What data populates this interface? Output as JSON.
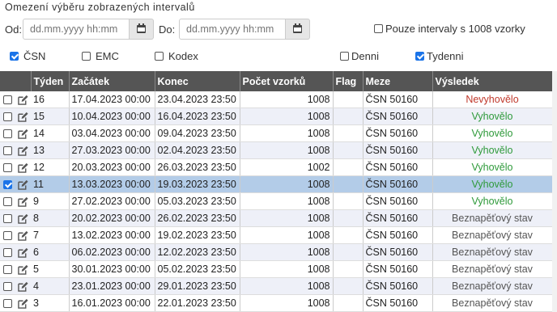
{
  "filter": {
    "heading": "Omezení výběru zobrazených intervalů",
    "from_label": "Od:",
    "to_label": "Do:",
    "from_placeholder": "dd.mm.yyyy hh:mm",
    "to_placeholder": "dd.mm.yyyy hh:mm",
    "only_full_label": "Pouze intervaly s 1008 vzorky",
    "only_full_checked": false,
    "options": [
      {
        "label": "ČSN",
        "checked": true
      },
      {
        "label": "EMC",
        "checked": false
      },
      {
        "label": "Kodex",
        "checked": false
      },
      {
        "label": "Denni",
        "checked": false
      },
      {
        "label": "Tydenni",
        "checked": true
      }
    ]
  },
  "table": {
    "columns": [
      "Týden",
      "Začátek",
      "Konec",
      "Počet vzorků",
      "Flag",
      "Meze",
      "Výsledek"
    ],
    "rows": [
      {
        "checked": false,
        "week": "16",
        "start": "17.04.2023 00:00",
        "end": "23.04.2023 23:50",
        "count": "1008",
        "flag": "",
        "limit": "ČSN 50160",
        "result": "Nevyhovělo",
        "status": "bad"
      },
      {
        "checked": false,
        "week": "15",
        "start": "10.04.2023 00:00",
        "end": "16.04.2023 23:50",
        "count": "1008",
        "flag": "",
        "limit": "ČSN 50160",
        "result": "Vyhovělo",
        "status": "ok"
      },
      {
        "checked": false,
        "week": "14",
        "start": "03.04.2023 00:00",
        "end": "09.04.2023 23:50",
        "count": "1008",
        "flag": "",
        "limit": "ČSN 50160",
        "result": "Vyhovělo",
        "status": "ok"
      },
      {
        "checked": false,
        "week": "13",
        "start": "27.03.2023 00:00",
        "end": "02.04.2023 23:50",
        "count": "1008",
        "flag": "",
        "limit": "ČSN 50160",
        "result": "Vyhovělo",
        "status": "ok"
      },
      {
        "checked": false,
        "week": "12",
        "start": "20.03.2023 00:00",
        "end": "26.03.2023 23:50",
        "count": "1002",
        "flag": "",
        "limit": "ČSN 50160",
        "result": "Vyhovělo",
        "status": "ok"
      },
      {
        "checked": true,
        "week": "11",
        "start": "13.03.2023 00:00",
        "end": "19.03.2023 23:50",
        "count": "1008",
        "flag": "",
        "limit": "ČSN 50160",
        "result": "Vyhovělo",
        "status": "ok"
      },
      {
        "checked": false,
        "week": "9",
        "start": "27.02.2023 00:00",
        "end": "05.03.2023 23:50",
        "count": "1008",
        "flag": "",
        "limit": "ČSN 50160",
        "result": "Vyhovělo",
        "status": "ok"
      },
      {
        "checked": false,
        "week": "8",
        "start": "20.02.2023 00:00",
        "end": "26.02.2023 23:50",
        "count": "1008",
        "flag": "",
        "limit": "ČSN 50160",
        "result": "Beznapěťový stav",
        "status": "off"
      },
      {
        "checked": false,
        "week": "7",
        "start": "13.02.2023 00:00",
        "end": "19.02.2023 23:50",
        "count": "1008",
        "flag": "",
        "limit": "ČSN 50160",
        "result": "Beznapěťový stav",
        "status": "off"
      },
      {
        "checked": false,
        "week": "6",
        "start": "06.02.2023 00:00",
        "end": "12.02.2023 23:50",
        "count": "1008",
        "flag": "",
        "limit": "ČSN 50160",
        "result": "Beznapěťový stav",
        "status": "off"
      },
      {
        "checked": false,
        "week": "5",
        "start": "30.01.2023 00:00",
        "end": "05.02.2023 23:50",
        "count": "1008",
        "flag": "",
        "limit": "ČSN 50160",
        "result": "Beznapěťový stav",
        "status": "off"
      },
      {
        "checked": false,
        "week": "4",
        "start": "23.01.2023 00:00",
        "end": "29.01.2023 23:50",
        "count": "1008",
        "flag": "",
        "limit": "ČSN 50160",
        "result": "Beznapěťový stav",
        "status": "off"
      },
      {
        "checked": false,
        "week": "3",
        "start": "16.01.2023 00:00",
        "end": "22.01.2023 23:50",
        "count": "1008",
        "flag": "",
        "limit": "ČSN 50160",
        "result": "Beznapěťový stav",
        "status": "off"
      }
    ]
  },
  "icons": {
    "row_edit": "edit-icon",
    "calendar": "calendar-icon"
  },
  "colors": {
    "header_bg": "#555555",
    "selected_row": "#b3cce8",
    "fail": "#c0392b",
    "pass": "#2e9a3a",
    "checkbox_on": "#1a73e8"
  }
}
